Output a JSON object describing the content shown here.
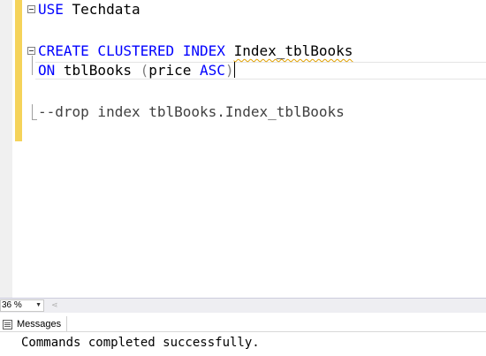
{
  "editor": {
    "lines": {
      "l1": {
        "kw": "USE",
        "rest": " Techdata"
      },
      "l3": {
        "kw": "CREATE CLUSTERED INDEX",
        "sp": " ",
        "name": "Index_tblBooks"
      },
      "l4": {
        "kw": "ON",
        "mid": " tblBooks ",
        "paren_open": "(",
        "col": "price ",
        "asc": "ASC",
        "paren_close": ")"
      },
      "l6": {
        "comment": "--drop index tblBooks.Index_tblBooks"
      }
    }
  },
  "zoom": {
    "value": "36 %"
  },
  "results": {
    "tab_label": "Messages",
    "message": "Commands completed successfully."
  },
  "colors": {
    "keyword": "#0000ff",
    "change_bar": "#f5d35a"
  }
}
